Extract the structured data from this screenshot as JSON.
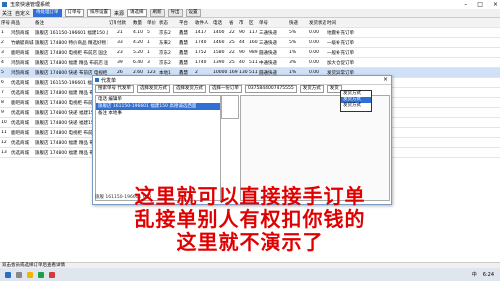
{
  "window": {
    "title": "玉泉快递管理系统"
  },
  "toolbar": {
    "items": [
      {
        "type": "label",
        "text": "关注"
      },
      {
        "type": "label",
        "text": "自定义"
      },
      {
        "type": "select",
        "text": "待处理订单",
        "style": "blue"
      },
      {
        "type": "select",
        "text": "订单号",
        "style": "white"
      },
      {
        "type": "select",
        "text": "排序设置",
        "style": "white"
      },
      {
        "type": "label",
        "text": "来源"
      },
      {
        "type": "select",
        "text": "请选择",
        "style": "white"
      },
      {
        "type": "button",
        "text": "刷新"
      },
      {
        "type": "button",
        "text": "导出"
      },
      {
        "type": "button",
        "text": "设置"
      }
    ]
  },
  "grid": {
    "headers": [
      "序号",
      "商品",
      "备注",
      "订单号",
      "付款",
      "数量",
      "单价",
      "状态",
      "平台",
      "收件人",
      "电话",
      "省",
      "市",
      "区",
      "单号",
      "快递",
      "发货状态",
      "时间"
    ],
    "rows": [
      [
        "1",
        "鸿鹄商城",
        "旗舰店 161150-196601 福建150 高德诚选西面",
        "",
        "21",
        "4.10",
        "5",
        "京东2",
        "鑫慧",
        "1417",
        "1400",
        "22",
        "90",
        "117382172",
        "三通快递",
        "5%",
        "0.00",
        "地震补充订单"
      ],
      [
        "2",
        "竹蜻蜓商城",
        "旗舰店 174800 特价商品 精选好物 西城街 布前店",
        "",
        "33",
        "4.20",
        "1",
        "东来2",
        "鑫慧",
        "1740",
        "1460",
        "25",
        "44",
        "160220501",
        "三通快递",
        "5%",
        "0.00",
        "一级补充订单"
      ],
      [
        "3",
        "鹿吧商城",
        "旗舰店 174800 电视柜 布前店 国企 福建 50店",
        "",
        "23",
        "5.20",
        "1",
        "京东2",
        "鑫慧",
        "1752",
        "1580",
        "22",
        "90",
        "989175177",
        "圆通快递",
        "1%",
        "0.00",
        "一般补充订单"
      ],
      [
        "4",
        "鸿鹄商城",
        "旗舰店 174800 福建 精品 布前店 国企 精选 布前",
        "",
        "39",
        "6.40",
        "3",
        "京东2",
        "鑫慧",
        "1740",
        "1390",
        "25",
        "40",
        "511282790",
        "中通快递",
        "3%",
        "0.00",
        "加大仓促订单"
      ],
      [
        "5",
        "鸿鹄商城",
        "旗舰店 174800 快递 布前店 电视柜 国企 精选 布前",
        "",
        "26",
        "2.60",
        "123",
        "本地1",
        "鑫慧",
        "2",
        "10000",
        "169",
        "130",
        "511715146",
        "圆通快递",
        "1%",
        "0.00",
        "发货异常订单"
      ],
      [
        "6",
        "优选商城",
        "旗舰店 161150-196601 福建150 高德诚选",
        "",
        "",
        "",
        "",
        "",
        "",
        "",
        "",
        "",
        "",
        "",
        "",
        "",
        "",
        ""
      ],
      [
        "7",
        "优选商城",
        "旗舰店 174800 福建 精品 布前店",
        "",
        "",
        "",
        "",
        "",
        "",
        "",
        "",
        "",
        "",
        "",
        "",
        "",
        "",
        ""
      ],
      [
        "8",
        "鹿吧商城",
        "旗舰店 174800 电视柜 布前店",
        "",
        "",
        "",
        "",
        "",
        "",
        "",
        "",
        "",
        "",
        "",
        "",
        "",
        "",
        ""
      ],
      [
        "9",
        "优选商城",
        "旗舰店 174800 快递 福建150",
        "",
        "",
        "",
        "",
        "",
        "",
        "",
        "",
        "",
        "",
        "",
        "",
        "",
        "",
        ""
      ],
      [
        "10",
        "优选商城",
        "旗舰店 174800 快递 福建150",
        "",
        "",
        "",
        "",
        "",
        "",
        "",
        "",
        "",
        "",
        "",
        "",
        "",
        "",
        ""
      ],
      [
        "11",
        "鹿吧商城",
        "旗舰店 174800 电视柜 布前店",
        "",
        "",
        "",
        "",
        "",
        "",
        "",
        "",
        "",
        "",
        "",
        "",
        "",
        "",
        ""
      ],
      [
        "12",
        "优选商城",
        "旗舰店 174800 福建 精品 布前店",
        "",
        "",
        "",
        "",
        "",
        "",
        "",
        "",
        "",
        "",
        "",
        "",
        "",
        "",
        ""
      ],
      [
        "13",
        "优选商城",
        "旗舰店 174800 福建 精品 布前店",
        "",
        "",
        "",
        "",
        "",
        "",
        "",
        "",
        "",
        "",
        "",
        "",
        "",
        "",
        ""
      ]
    ]
  },
  "dialog": {
    "title": "代发单",
    "tools": [
      "搜索单号 代发单",
      "选择发货方式",
      "选择发货方式",
      "选择一份订单",
      "0375844007475555",
      "发货方式",
      "发货"
    ],
    "list": [
      "电话 编辑单",
      "旗舰店 161150-196601 福建150 高德诚选西面",
      "备注 本地事"
    ],
    "status": "旗舰 161150-196601 663"
  },
  "popup": {
    "items": [
      "发货方式",
      "发货方式",
      "发货方式"
    ],
    "selected": 1
  },
  "status_text": "双击会员或选择订单后查看详情",
  "caption": [
    "这里就可以直接接手订单",
    "乱接单别人有权扣你钱的",
    "这里就不演示了"
  ],
  "tray": {
    "time": "6:24",
    "lang": "中"
  },
  "colors": {
    "caption": "#e00000",
    "accent": "#2f6fd6"
  }
}
